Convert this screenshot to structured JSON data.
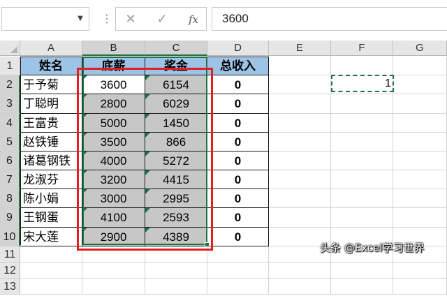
{
  "formula_bar": {
    "name_box": "",
    "separator": "⋮",
    "cancel_symbol": "✕",
    "enter_symbol": "✓",
    "fx_label": "fx",
    "formula_value": "3600"
  },
  "columns": [
    "A",
    "B",
    "C",
    "D",
    "E",
    "F",
    "G"
  ],
  "selected_columns": [
    "B",
    "C"
  ],
  "rows": [
    "1",
    "2",
    "3",
    "4",
    "5",
    "6",
    "7",
    "8",
    "9",
    "10",
    "11",
    "12",
    "13"
  ],
  "selected_rows": [
    "2",
    "3",
    "4",
    "5",
    "6",
    "7",
    "8",
    "9",
    "10"
  ],
  "table": {
    "headers": [
      "姓名",
      "底薪",
      "奖金",
      "总收入"
    ],
    "rows": [
      {
        "name": "于予菊",
        "base": "3600",
        "bonus": "6154",
        "total": "0"
      },
      {
        "name": "丁聪明",
        "base": "2800",
        "bonus": "6029",
        "total": "0"
      },
      {
        "name": "王富贵",
        "base": "5000",
        "bonus": "1450",
        "total": "0"
      },
      {
        "name": "赵铁锤",
        "base": "3500",
        "bonus": "866",
        "total": "0"
      },
      {
        "name": "诸葛钢铁",
        "base": "4000",
        "bonus": "5272",
        "total": "0"
      },
      {
        "name": "龙淑芬",
        "base": "3200",
        "bonus": "4415",
        "total": "0"
      },
      {
        "name": "陈小娟",
        "base": "3000",
        "bonus": "2995",
        "total": "0"
      },
      {
        "name": "王钢蛋",
        "base": "4100",
        "bonus": "2593",
        "total": "0"
      },
      {
        "name": "宋大莲",
        "base": "2900",
        "bonus": "4389",
        "total": "0"
      }
    ]
  },
  "copied_cell": {
    "ref": "F2",
    "value": "1"
  },
  "watermark": "头条 @Excel学习世界",
  "colors": {
    "header_fill": "#9dc3e6",
    "selection_fill": "#c7c7c7",
    "selection_border": "#217346",
    "highlight_box": "#e02020"
  }
}
